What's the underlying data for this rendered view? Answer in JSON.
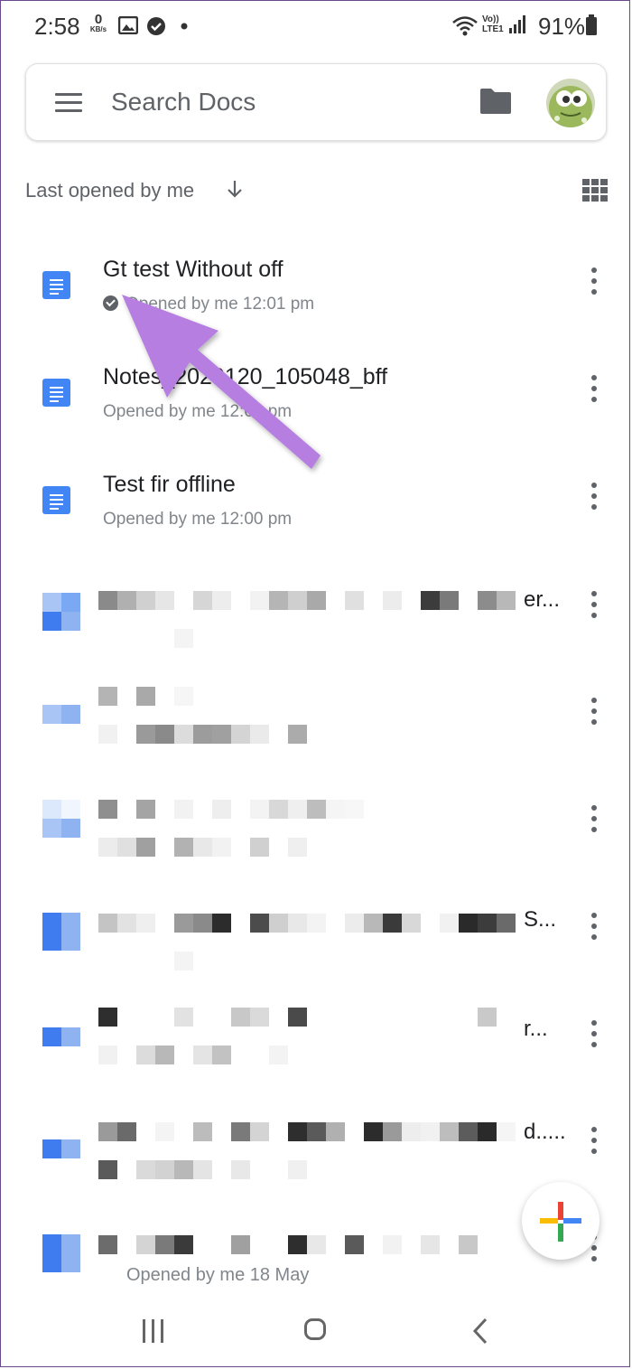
{
  "status_bar": {
    "time": "2:58",
    "net_speed_value": "0",
    "net_speed_unit": "KB/s",
    "network_label_top": "Vo))",
    "network_label_bottom": "LTE1",
    "battery": "91%"
  },
  "search": {
    "placeholder": "Search Docs"
  },
  "sort": {
    "label": "Last opened by me"
  },
  "files": [
    {
      "title": "Gt test Without off",
      "meta": "Opened by me 12:01 pm",
      "offline": true
    },
    {
      "title": "Notes_2020120_105048_bff",
      "meta": "Opened by me 12:01 pm",
      "offline": false
    },
    {
      "title": "Test fir offline",
      "meta": "Opened by me 12:00 pm",
      "offline": false
    }
  ],
  "redacted_tails": [
    "er...",
    "",
    "",
    "S...",
    "r...",
    "d....."
  ],
  "partial_meta": "Opened by me 18 May",
  "icons": {
    "menu": "hamburger-menu-icon",
    "folder": "folder-icon",
    "avatar": "avatar-image",
    "sort": "arrow-down-icon",
    "view": "grid-view-icon",
    "more": "more-vert-icon",
    "fab": "google-plus-icon"
  },
  "colors": {
    "docs_blue": "#4285f4",
    "annotation_arrow": "#b57ee0",
    "text_secondary": "#80868b"
  }
}
